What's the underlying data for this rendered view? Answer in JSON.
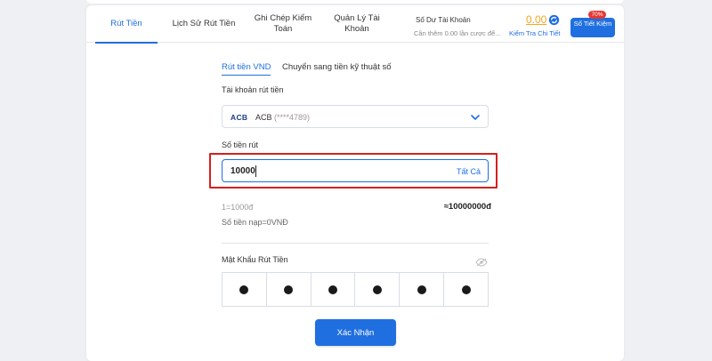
{
  "header": {
    "tabs": [
      {
        "label": "Rút Tiền"
      },
      {
        "label": "Lịch Sử Rút Tiền"
      },
      {
        "label": "Ghi Chép Kiểm Toán"
      },
      {
        "label": "Quản Lý Tài Khoản"
      }
    ],
    "balance_label": "Số Dư Tài Khoản",
    "balance_value": "0.00",
    "subline": "Cần thêm 0.00 lần cược để...",
    "detail_link": "Kiểm Tra Chi Tiết",
    "save_button": "Số Tiết Kiệm",
    "save_badge": "70%",
    "refresh_icon": "refresh-icon",
    "accent_color": "#1f6fe0",
    "balance_color": "#f5a623"
  },
  "subtabs": [
    {
      "label": "Rút tiền VND"
    },
    {
      "label": "Chuyển sang tiền kỹ thuật số"
    }
  ],
  "form": {
    "account_label": "Tài khoản rút tiền",
    "bank_logo": "ACB",
    "bank_name": "ACB",
    "bank_account": "(****4789)",
    "amount_label": "Số tiền rút",
    "amount_value": "10000",
    "all_link": "Tất Cả",
    "rate": "1=1000đ",
    "total": "≈10000000đ",
    "deposit_info": "Số tiền nạp=0VNĐ",
    "password_label": "Mật Khẩu Rút Tiền",
    "pin_digits": 6,
    "confirm_button": "Xác Nhận",
    "highlight_color": "#d42020"
  }
}
